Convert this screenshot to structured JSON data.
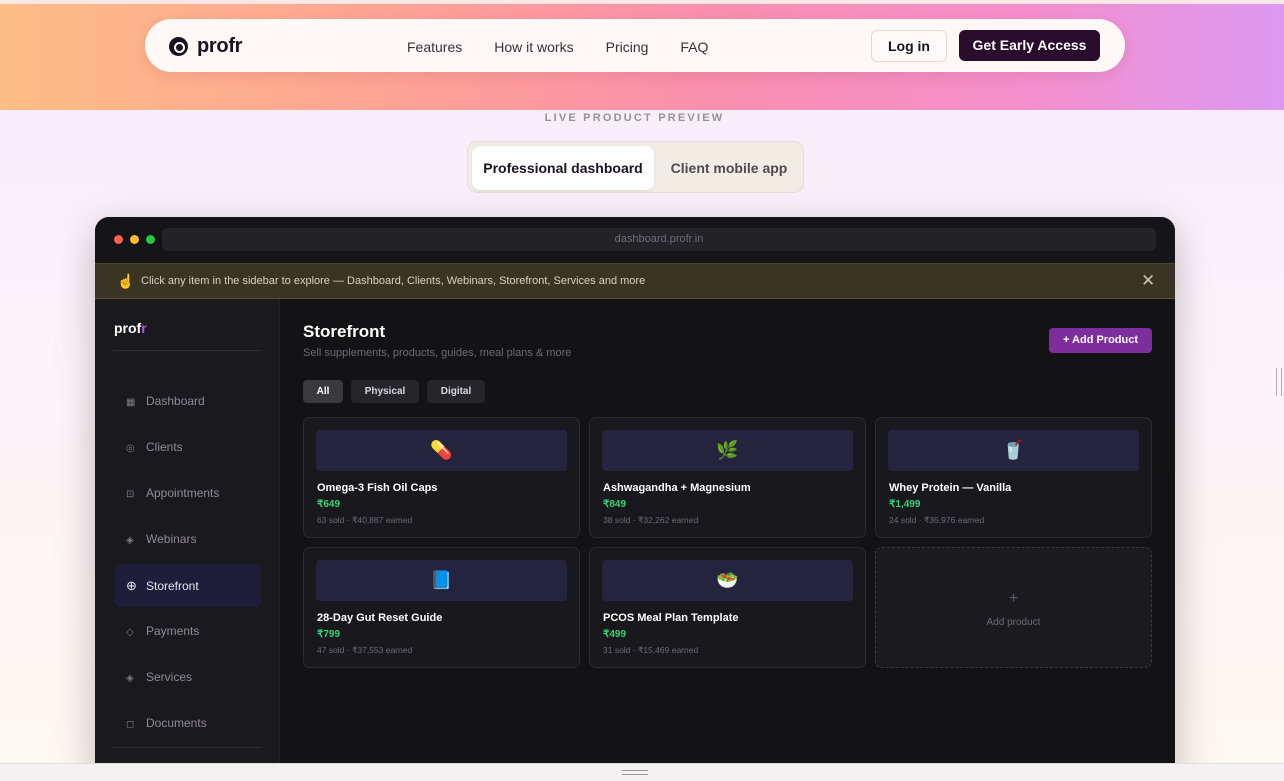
{
  "nav": {
    "brand": "profr",
    "links": [
      "Features",
      "How it works",
      "Pricing",
      "FAQ"
    ],
    "login_label": "Log in",
    "cta_label": "Get Early Access"
  },
  "preview": {
    "label": "LIVE PRODUCT PREVIEW",
    "toggle": {
      "active": "Professional dashboard",
      "inactive": "Client mobile app"
    }
  },
  "window": {
    "url": "dashboard.profr.in",
    "dots": [
      "#ff5f57",
      "#febc2e",
      "#28c840"
    ],
    "banner": {
      "icon": "pointing-hand-icon",
      "text": "Click any item in the sidebar to explore — Dashboard, Clients, Webinars, Storefront, Services and more",
      "close_icon": "close-icon"
    }
  },
  "sidebar": {
    "brand": "prof",
    "brand_accent": "r",
    "items": [
      {
        "label": "Dashboard",
        "icon": "▦",
        "icon_name": "grid-icon",
        "active": false
      },
      {
        "label": "Clients",
        "icon": "◎",
        "icon_name": "clients-icon",
        "active": false
      },
      {
        "label": "Appointments",
        "icon": "⊡",
        "icon_name": "calendar-icon",
        "active": false
      },
      {
        "label": "Webinars",
        "icon": "◈",
        "icon_name": "webinar-icon",
        "active": false
      },
      {
        "label": "Storefront",
        "icon": "⊕",
        "icon_name": "storefront-icon",
        "active": true
      },
      {
        "label": "Payments",
        "icon": "◇",
        "icon_name": "payments-icon",
        "active": false
      },
      {
        "label": "Services",
        "icon": "◈",
        "icon_name": "services-icon",
        "active": false
      },
      {
        "label": "Documents",
        "icon": "◻",
        "icon_name": "documents-icon",
        "active": false
      }
    ]
  },
  "storefront": {
    "title": "Storefront",
    "subtitle": "Sell supplements, products, guides, meal plans & more",
    "add_button": "+ Add Product",
    "filters": [
      "All",
      "Physical",
      "Digital"
    ],
    "active_filter": "All",
    "products": [
      {
        "emoji": "💊",
        "icon_name": "pill-icon",
        "name": "Omega-3 Fish Oil Caps",
        "price": "₹649",
        "meta": "63 sold · ₹40,887 earned"
      },
      {
        "emoji": "🌿",
        "icon_name": "herb-icon",
        "name": "Ashwagandha + Magnesium",
        "price": "₹849",
        "meta": "38 sold · ₹32,262 earned"
      },
      {
        "emoji": "🥤",
        "icon_name": "shaker-icon",
        "name": "Whey Protein — Vanilla",
        "price": "₹1,499",
        "meta": "24 sold · ₹35,976 earned"
      },
      {
        "emoji": "📘",
        "icon_name": "book-icon",
        "name": "28-Day Gut Reset Guide",
        "price": "₹799",
        "meta": "47 sold · ₹37,553 earned"
      },
      {
        "emoji": "🥗",
        "icon_name": "salad-icon",
        "name": "PCOS Meal Plan Template",
        "price": "₹499",
        "meta": "31 sold · ₹15,469 earned"
      }
    ],
    "add_card": {
      "plus": "+",
      "label": "Add product"
    }
  }
}
